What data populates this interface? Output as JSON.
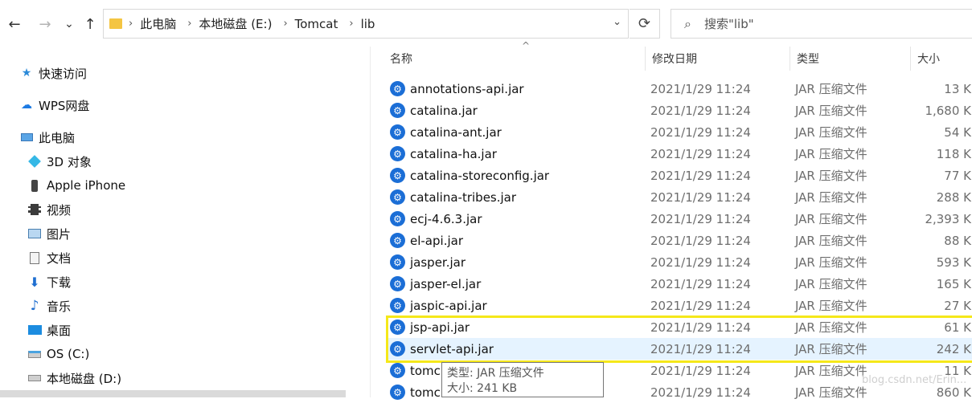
{
  "nav": {
    "back": "←",
    "forward": "→",
    "recent": "⌄",
    "up": "↑"
  },
  "address": {
    "crumbs": [
      "此电脑",
      "本地磁盘 (E:)",
      "Tomcat",
      "lib"
    ],
    "dropdown": "⌄",
    "refresh": "⟳"
  },
  "search": {
    "placeholder": "搜索\"lib\""
  },
  "sidebar": {
    "items": [
      {
        "label": "快速访问",
        "icon": "star-icon"
      },
      {
        "label": "WPS网盘",
        "icon": "cloud-icon"
      },
      {
        "label": "此电脑",
        "icon": "computer-icon"
      },
      {
        "label": "3D 对象",
        "icon": "cube-icon"
      },
      {
        "label": "Apple iPhone",
        "icon": "phone-icon"
      },
      {
        "label": "视频",
        "icon": "video-icon"
      },
      {
        "label": "图片",
        "icon": "picture-icon"
      },
      {
        "label": "文档",
        "icon": "document-icon"
      },
      {
        "label": "下载",
        "icon": "download-icon"
      },
      {
        "label": "音乐",
        "icon": "music-icon"
      },
      {
        "label": "桌面",
        "icon": "desktop-icon"
      },
      {
        "label": "OS (C:)",
        "icon": "drive-c-icon"
      },
      {
        "label": "本地磁盘 (D:)",
        "icon": "drive-d-icon"
      }
    ]
  },
  "columns": {
    "name": "名称",
    "date": "修改日期",
    "type": "类型",
    "size": "大小"
  },
  "files": [
    {
      "name": "annotations-api.jar",
      "date": "2021/1/29 11:24",
      "type": "JAR 压缩文件",
      "size": "13 K"
    },
    {
      "name": "catalina.jar",
      "date": "2021/1/29 11:24",
      "type": "JAR 压缩文件",
      "size": "1,680 K"
    },
    {
      "name": "catalina-ant.jar",
      "date": "2021/1/29 11:24",
      "type": "JAR 压缩文件",
      "size": "54 K"
    },
    {
      "name": "catalina-ha.jar",
      "date": "2021/1/29 11:24",
      "type": "JAR 压缩文件",
      "size": "118 K"
    },
    {
      "name": "catalina-storeconfig.jar",
      "date": "2021/1/29 11:24",
      "type": "JAR 压缩文件",
      "size": "77 K"
    },
    {
      "name": "catalina-tribes.jar",
      "date": "2021/1/29 11:24",
      "type": "JAR 压缩文件",
      "size": "288 K"
    },
    {
      "name": "ecj-4.6.3.jar",
      "date": "2021/1/29 11:24",
      "type": "JAR 压缩文件",
      "size": "2,393 K"
    },
    {
      "name": "el-api.jar",
      "date": "2021/1/29 11:24",
      "type": "JAR 压缩文件",
      "size": "88 K"
    },
    {
      "name": "jasper.jar",
      "date": "2021/1/29 11:24",
      "type": "JAR 压缩文件",
      "size": "593 K"
    },
    {
      "name": "jasper-el.jar",
      "date": "2021/1/29 11:24",
      "type": "JAR 压缩文件",
      "size": "165 K"
    },
    {
      "name": "jaspic-api.jar",
      "date": "2021/1/29 11:24",
      "type": "JAR 压缩文件",
      "size": "27 K"
    },
    {
      "name": "jsp-api.jar",
      "date": "2021/1/29 11:24",
      "type": "JAR 压缩文件",
      "size": "61 K"
    },
    {
      "name": "servlet-api.jar",
      "date": "2021/1/29 11:24",
      "type": "JAR 压缩文件",
      "size": "242 K"
    },
    {
      "name": "tomc",
      "date": "2021/1/29 11:24",
      "type": "JAR 压缩文件",
      "size": "11 K"
    },
    {
      "name": "tomc",
      "date": "2021/1/29 11:24",
      "type": "JAR 压缩文件",
      "size": "860 K"
    }
  ],
  "tooltip": {
    "type_line": "类型: JAR 压缩文件",
    "size_line": "大小: 241 KB"
  },
  "watermark": "blog.csdn.net/Erin...",
  "colors": {
    "selection": "#e5f3ff",
    "highlight": "#f5e81a",
    "jar_icon": "#1b6ed6"
  }
}
